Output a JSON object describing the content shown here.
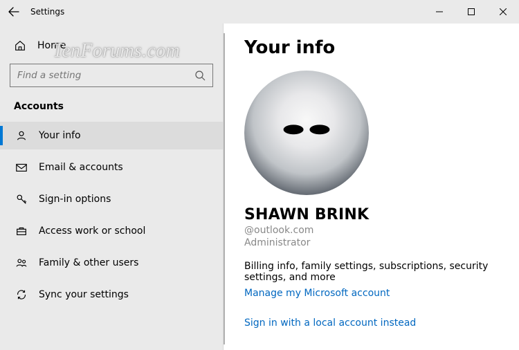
{
  "window": {
    "title": "Settings"
  },
  "watermark": "TenForums.com",
  "sidebar": {
    "home_label": "Home",
    "search_placeholder": "Find a setting",
    "category_label": "Accounts",
    "items": [
      {
        "label": "Your info"
      },
      {
        "label": "Email & accounts"
      },
      {
        "label": "Sign-in options"
      },
      {
        "label": "Access work or school"
      },
      {
        "label": "Family & other users"
      },
      {
        "label": "Sync your settings"
      }
    ]
  },
  "content": {
    "page_title": "Your info",
    "user_name": "SHAWN BRINK",
    "user_email": "@outlook.com",
    "user_role": "Administrator",
    "billing_desc": "Billing info, family settings, subscriptions, security settings, and more",
    "manage_link": "Manage my Microsoft account",
    "local_account_link": "Sign in with a local account instead"
  }
}
